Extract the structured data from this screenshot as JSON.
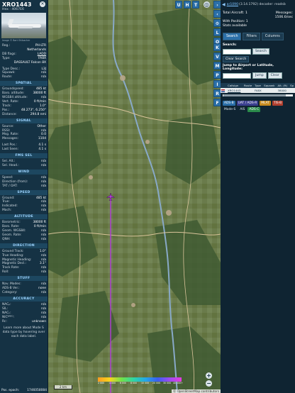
{
  "colors": {
    "panel_bg": "#153244",
    "section_text": "#9ed4ff",
    "accent": "#2b6fa8",
    "track": "#b23ad8"
  },
  "left": {
    "callsign": "XRO1443",
    "hex": "Hex :  4067E6",
    "photo_credit": "Image © Bart Ohlbacher",
    "info": [
      {
        "k": "Reg.:",
        "v": "PH-LTR"
      },
      {
        "k": "",
        "v": "Netherlands"
      },
      {
        "k": "DB flags:",
        "v": "LADD"
      },
      {
        "k": "Type:",
        "v": "FA8X"
      },
      {
        "k": "",
        "v": "DASSAULT Falcon 8X"
      },
      {
        "k": "Type Desc.:",
        "v": "L3J"
      },
      {
        "k": "Squawk:",
        "v": "n/a"
      },
      {
        "k": "Route:",
        "v": "n/a"
      }
    ],
    "sections": {
      "spatial": "SPATIAL",
      "signal": "SIGNAL",
      "fms": "FMS SEL",
      "wind": "WIND",
      "speed": "SPEED",
      "altitude": "ALTITUDE",
      "direction": "DIRECTION",
      "stuff": "STUFF",
      "accuracy": "ACCURACY"
    },
    "spatial": [
      {
        "k": "Groundspeed:",
        "v": "485 kt"
      },
      {
        "k": "Baro. altitude:",
        "v": "38000 ft"
      },
      {
        "k": "WGS84 altitude:",
        "v": "n/a"
      },
      {
        "k": "Vert. Rate:",
        "v": "0 ft/min"
      },
      {
        "k": "Track:",
        "v": "1.0°"
      },
      {
        "k": "Pos.:",
        "v": "48.273°, 6.250°"
      },
      {
        "k": "Distance:",
        "v": "294.8 nmi"
      }
    ],
    "signal": [
      {
        "k": "Source:",
        "v": "Other"
      },
      {
        "k": "RSSI:",
        "v": "n/a"
      },
      {
        "k": "Msg. Rate:",
        "v": "0.0"
      },
      {
        "k": "Messages:",
        "v": "1104"
      },
      {
        "k": "Last Pos.:",
        "v": "4.1 s"
      },
      {
        "k": "Last Seen:",
        "v": "4.1 s"
      }
    ],
    "fms": [
      {
        "k": "Sel. Alt.:",
        "v": "n/a"
      },
      {
        "k": "Sel. Head.:",
        "v": "n/a"
      }
    ],
    "wind": [
      {
        "k": "Speed:",
        "v": "n/a"
      },
      {
        "k": "Direction (from):",
        "v": "n/a"
      },
      {
        "k": "TAT / OAT:",
        "v": "n/a"
      }
    ],
    "speed": [
      {
        "k": "Ground:",
        "v": "485 kt"
      },
      {
        "k": "True:",
        "v": "n/a"
      },
      {
        "k": "Indicated:",
        "v": "n/a"
      },
      {
        "k": "Mach:",
        "v": "n/a"
      }
    ],
    "altitude": [
      {
        "k": "Barometric:",
        "v": "38000 ft"
      },
      {
        "k": "Baro. Rate:",
        "v": "0 ft/min"
      },
      {
        "k": "Geom. WGS84:",
        "v": "n/a"
      },
      {
        "k": "Geom. Rate:",
        "v": "n/a"
      },
      {
        "k": "QNH:",
        "v": "n/a"
      }
    ],
    "direction": [
      {
        "k": "Ground Track:",
        "v": "1.0°"
      },
      {
        "k": "True Heading:",
        "v": "n/a"
      },
      {
        "k": "Magnetic Heading:",
        "v": "n/a"
      },
      {
        "k": "Magnetic Decl.:",
        "v": "3.1°"
      },
      {
        "k": "Track Rate:",
        "v": "n/a"
      },
      {
        "k": "Roll:",
        "v": "n/a"
      }
    ],
    "stuff": [
      {
        "k": "Nav. Modes:",
        "v": "n/a"
      },
      {
        "k": "ADS-B Ver.:",
        "v": "none"
      },
      {
        "k": "Category:",
        "v": "n/a"
      }
    ],
    "accuracy": [
      {
        "k": "NACₚ:",
        "v": "n/a"
      },
      {
        "k": "SIL:",
        "v": "n/a"
      },
      {
        "k": "NACᵥ:",
        "v": "n/a"
      },
      {
        "k": "NICᴮᴬᴿᴼ:",
        "v": "n/a"
      },
      {
        "k": "Rc:",
        "v": "unknown"
      }
    ],
    "learn_more": "Learn more about Mode S data type by hovering over each data label.",
    "pos_epoch_label": "Pos. epoch:",
    "pos_epoch_value": "1746058084"
  },
  "map": {
    "top_buttons": [
      "U",
      "H",
      "T"
    ],
    "scale_label": "2 km",
    "attribution": "© OpenStreetMap contributors",
    "legend_ticks": [
      "2 000",
      "4 000",
      "6 000",
      "8 000",
      "10 000",
      "20 000",
      "30 000",
      "40 000+"
    ]
  },
  "side_buttons": [
    "L",
    "O",
    "K",
    "V",
    "M",
    "P",
    "I",
    "R",
    "F"
  ],
  "right": {
    "version_link": "ar1090",
    "version_text": "(3.14.1792) decoder: readsb",
    "stats": {
      "total_label": "Total Aircraft:",
      "total_value": "1",
      "messages_label": "Messages:",
      "messages_value": "1506.6/sec",
      "withpos_label": "With Position:",
      "withpos_value": "1",
      "stats_label": "Stats available"
    },
    "tabs": [
      "Search",
      "Filters",
      "Columns"
    ],
    "search_label": "Search:",
    "search_button": "Search",
    "clear_search": "Clear Search",
    "jump_label": "Jump to Airport or Latitude, Longitude:",
    "jump_button": "Jump",
    "clear_button": "Clear",
    "table": {
      "headers": [
        "",
        "Callsign",
        "Route",
        "Type",
        "Squawk",
        "Alt. (ft)",
        "Sp"
      ],
      "rows": [
        {
          "callsign": "XRO1443",
          "route": "",
          "type": "FA8X",
          "squawk": "",
          "alt": "38000",
          "sp": ""
        }
      ]
    },
    "badges": [
      "ADS-B",
      "UAT / ADS-R",
      "MLAT",
      "TIS-B",
      "Mode-S",
      "AIS",
      "ADS-C"
    ]
  }
}
